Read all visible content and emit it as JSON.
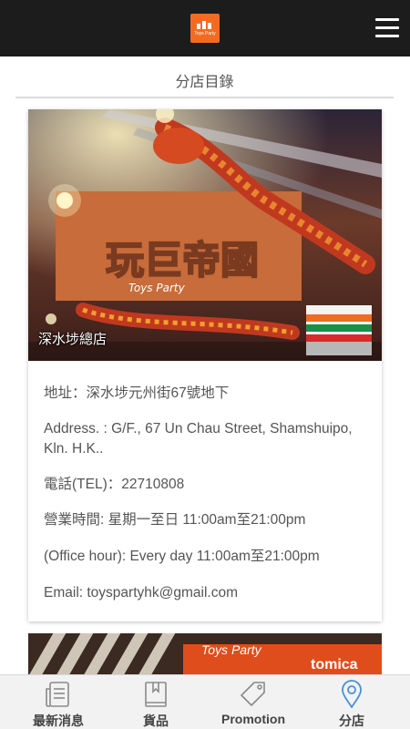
{
  "header": {
    "logo_text": "Toys Party",
    "menu_icon": "hamburger-icon"
  },
  "page": {
    "title": "分店目錄"
  },
  "store": {
    "photo_caption": "深水埗總店",
    "address_zh": "地址：深水埗元州街67號地下",
    "address_en": "Address. : G/F., 67 Un Chau Street, Shamshuipo, Kln. H.K..",
    "tel": "電話(TEL)：22710808",
    "hours_zh": "營業時間: 星期一至日  11:00am至21:00pm",
    "hours_en": "(Office hour): Every day 11:00am至21:00pm",
    "email": "Email: toyspartyhk@gmail.com"
  },
  "store2": {
    "sign_text": "Toys Party",
    "sign_text2": "tomica"
  },
  "tabs": [
    {
      "label": "最新消息",
      "icon": "news-icon"
    },
    {
      "label": "貨品",
      "icon": "book-icon"
    },
    {
      "label": "Promotion",
      "icon": "tag-icon"
    },
    {
      "label": "分店",
      "icon": "location-pin-icon"
    }
  ],
  "colors": {
    "topbar": "#1c1c1c",
    "logo": "#f26b22",
    "active_tab": "#4a90d9"
  }
}
